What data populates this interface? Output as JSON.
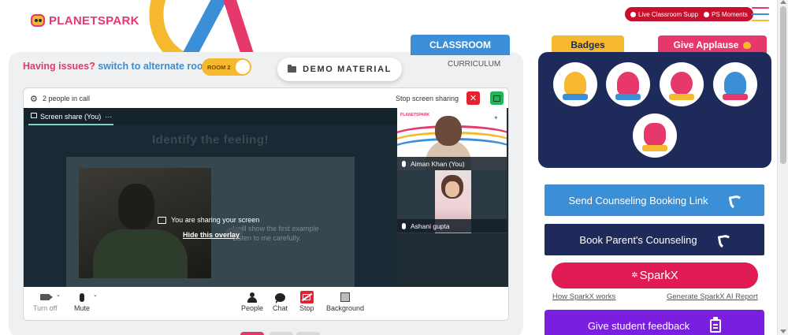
{
  "brand": {
    "name_part1": "PLANET",
    "name_part2": "SPARK"
  },
  "header": {
    "live_support": "Live Classroom Support",
    "ps_moments": "PS Moments"
  },
  "tabs": {
    "classroom": "CLASSROOM",
    "curriculum": "CURRICULUM"
  },
  "issues": {
    "question": "Having issues?",
    "switch": "switch to alternate room"
  },
  "room_toggle": {
    "label": "ROOM 2"
  },
  "demo_material": "DEMO MATERIAL",
  "meet": {
    "people_in_call": "2 people in call",
    "stop_screen_sharing": "Stop screen sharing",
    "screen_share_label": "Screen share (You)",
    "slide_title": "Identify the feeling!",
    "sharing_message": "You are sharing your screen",
    "hide_overlay": "Hide this overlay",
    "slide_text_line1": "I will show the first example",
    "slide_text_line2": "Listen to me carefully.",
    "tile_logo": "PLANETSPARK",
    "participants": [
      {
        "name": "Aiman Khan (You)"
      },
      {
        "name": "Ashani gupta"
      }
    ],
    "controls": {
      "camera": "Turn off",
      "mic": "Mute",
      "people": "People",
      "chat": "Chat",
      "stop": "Stop",
      "background": "Background"
    }
  },
  "badges": {
    "tab_label": "Badges",
    "applause_label": "Give Applause",
    "colors": [
      "#f5b82e",
      "#e7386c",
      "#e7386c",
      "#3b8fd6",
      "#e7386c"
    ]
  },
  "actions": {
    "counseling_link": "Send Counseling Booking Link",
    "parent_counseling": "Book Parent's Counseling",
    "sparkx": "SparkX",
    "how_sparkx_works": "How SparkX works",
    "generate_report": "Generate SparkX AI Report",
    "student_feedback": "Give student feedback"
  },
  "colors": {
    "brand_pink": "#e7386c",
    "brand_blue": "#3b8fd6",
    "brand_yellow": "#f5b82e",
    "navy": "#1d2a5a",
    "purple": "#7a1fe0"
  }
}
